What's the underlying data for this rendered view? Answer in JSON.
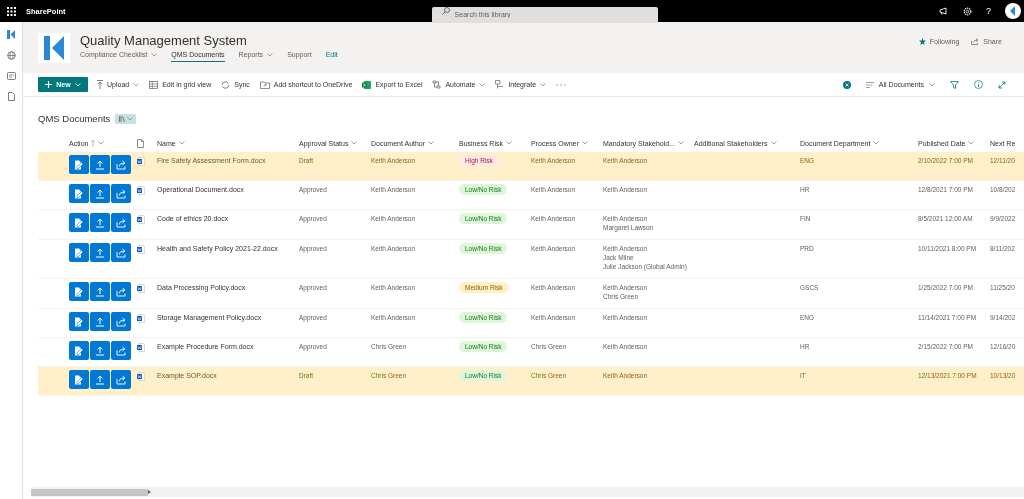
{
  "top_bar": {
    "app_name": "SharePoint",
    "search": {
      "placeholder": "Search this library"
    },
    "help": "?"
  },
  "site": {
    "title": "Quality Management System",
    "nav": [
      {
        "label": "Compliance Checklist",
        "kind": "tab",
        "dropdown": true,
        "selected": false
      },
      {
        "label": "QMS Documents",
        "kind": "tab",
        "dropdown": false,
        "selected": true
      },
      {
        "label": "Reports",
        "kind": "tab",
        "dropdown": true,
        "selected": false
      },
      {
        "label": "Support",
        "kind": "tab",
        "dropdown": false,
        "selected": false
      },
      {
        "label": "Edit",
        "kind": "edit",
        "dropdown": false,
        "selected": false
      }
    ],
    "actions": [
      {
        "label": "Following"
      },
      {
        "label": "Share"
      }
    ]
  },
  "command_bar": {
    "new_button": "New",
    "items": [
      {
        "label": "Upload",
        "dropdown": true
      },
      {
        "label": "Edit in grid view",
        "dropdown": false
      },
      {
        "label": "Sync",
        "dropdown": false
      },
      {
        "label": "Add shortcut to OneDrive",
        "dropdown": false
      },
      {
        "label": "Export to Excel",
        "dropdown": false
      },
      {
        "label": "Automate",
        "dropdown": true
      },
      {
        "label": "Integrate",
        "dropdown": true
      }
    ],
    "view": "All Documents"
  },
  "library": {
    "title": "QMS Documents",
    "columns": [
      {
        "label": "Action",
        "sorted": true
      },
      {
        "label": "Name",
        "sorted": false
      },
      {
        "label": "Approval Status",
        "sorted": false
      },
      {
        "label": "Document Author",
        "sorted": false
      },
      {
        "label": "Business Risk",
        "sorted": false
      },
      {
        "label": "Process Owner",
        "sorted": false
      },
      {
        "label": "Mandatory Stakehold...",
        "sorted": false
      },
      {
        "label": "Additional Stakeholders",
        "sorted": false
      },
      {
        "label": "Document Department",
        "sorted": false
      },
      {
        "label": "Published Date",
        "sorted": false
      },
      {
        "label": "Next Re",
        "sorted": false
      }
    ],
    "rows": [
      {
        "highlighted": true,
        "name": "Fire Safety Assessment Form.docx",
        "approval": "Draft",
        "author": "Keith Anderson",
        "risk": {
          "label": "High Risk",
          "kind": "high"
        },
        "owner": "Keith Anderson",
        "mandatory": [
          "Keith Anderson"
        ],
        "department": "ENG",
        "published": "2/10/2022 7:00 PM",
        "next_review": "12/11/20"
      },
      {
        "highlighted": false,
        "name": "Operational Document.docx",
        "approval": "Approved",
        "author": "Keith Anderson",
        "risk": {
          "label": "Low/No Risk",
          "kind": "low"
        },
        "owner": "Keith Anderson",
        "mandatory": [
          "Keith Anderson"
        ],
        "department": "HR",
        "published": "12/8/2021 7:00 PM",
        "next_review": "10/8/202"
      },
      {
        "highlighted": false,
        "name": "Code of ethics 20.docx",
        "approval": "Approved",
        "author": "Keith Anderson",
        "risk": {
          "label": "Low/No Risk",
          "kind": "low"
        },
        "owner": "Keith Anderson",
        "mandatory": [
          "Keith Anderson",
          "Margaret Lawson"
        ],
        "department": "FIN",
        "published": "8/5/2021 12:00 AM",
        "next_review": "9/9/2022"
      },
      {
        "highlighted": false,
        "name": "Health and Safety Policy 2021-22.docx",
        "approval": "Approved",
        "author": "Keith Anderson",
        "risk": {
          "label": "Low/No Risk",
          "kind": "low"
        },
        "owner": "Keith Anderson",
        "mandatory": [
          "Keith Anderson",
          "Jack Milne",
          "Julie Jackson (Global Admin)"
        ],
        "department": "PRD",
        "published": "10/11/2021 8:00 PM",
        "next_review": "8/11/202"
      },
      {
        "highlighted": false,
        "name": "Data Processing Policy.docx",
        "approval": "Approved",
        "author": "Keith Anderson",
        "risk": {
          "label": "Medium Risk",
          "kind": "medium"
        },
        "owner": "Keith Anderson",
        "mandatory": [
          "Keith Anderson",
          "Chris Green"
        ],
        "department": "GSCS",
        "published": "1/25/2022 7:00 PM",
        "next_review": "11/25/20"
      },
      {
        "highlighted": false,
        "name": "Storage Management Policy.docx",
        "approval": "Approved",
        "author": "Keith Anderson",
        "risk": {
          "label": "Low/No Risk",
          "kind": "low"
        },
        "owner": "Keith Anderson",
        "mandatory": [
          "Keith Anderson"
        ],
        "department": "ENG",
        "published": "11/14/2021 7:00 PM",
        "next_review": "9/14/202"
      },
      {
        "highlighted": false,
        "name": "Example Procedure Form.docx",
        "approval": "Approved",
        "author": "Chris Green",
        "risk": {
          "label": "Low/No Risk",
          "kind": "low"
        },
        "owner": "Chris Green",
        "mandatory": [
          "Keith Anderson"
        ],
        "department": "HR",
        "published": "2/15/2022 7:00 PM",
        "next_review": "12/16/20"
      },
      {
        "highlighted": true,
        "name": "Example SOP.docx",
        "approval": "Draft",
        "author": "Chris Green",
        "risk": {
          "label": "Low/No Risk",
          "kind": "low"
        },
        "owner": "Chris Green",
        "mandatory": [
          "Keith Anderson"
        ],
        "department": "IT",
        "published": "12/13/2021 7:00 PM",
        "next_review": "10/13/20"
      }
    ]
  }
}
